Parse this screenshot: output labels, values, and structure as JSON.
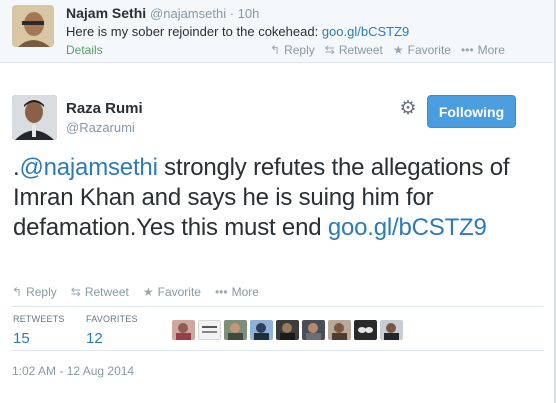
{
  "previous_tweet": {
    "name": "Najam Sethi",
    "handle_time": "@najamsethi · 10h",
    "text_prefix": "Here is my sober rejoinder to the cokehead: ",
    "link": "goo.gl/bCSTZ9",
    "details_label": "Details",
    "actions": {
      "reply": "Reply",
      "retweet": "Retweet",
      "favorite": "Favorite",
      "more": "More"
    }
  },
  "tweet": {
    "name": "Raza Rumi",
    "handle": "@Razarumi",
    "follow_label": "Following",
    "text_dot": ".",
    "mention": "@najamsethi",
    "text_body": " strongly refutes the allegations of Imran Khan and says he is suing him for defamation.Yes this must end ",
    "link": "goo.gl/bCSTZ9",
    "actions": {
      "reply": "Reply",
      "retweet": "Retweet",
      "favorite": "Favorite",
      "more": "More"
    },
    "stats": {
      "retweets_label": "RETWEETS",
      "retweets": "15",
      "favorites_label": "FAVORITES",
      "favorites": "12"
    },
    "timestamp": "1:02 AM - 12 Aug 2014"
  },
  "colors": {
    "link": "#2b7bb9",
    "follow_button": "#4a9ee0",
    "muted": "#8899a6"
  },
  "icons": [
    "reply-icon",
    "retweet-icon",
    "favorite-star-icon",
    "more-dots-icon",
    "gear-icon"
  ]
}
